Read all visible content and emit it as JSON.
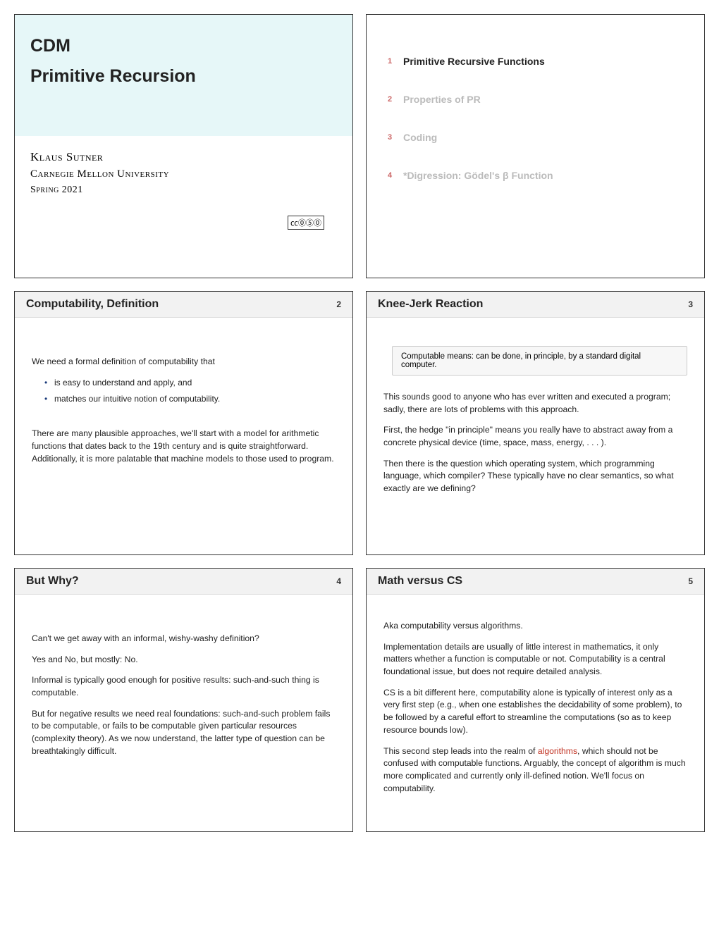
{
  "titleSlide": {
    "line1": "CDM",
    "line2": "Primitive Recursion",
    "author": "Klaus Sutner",
    "university": "Carnegie Mellon University",
    "term": "Spring 2021",
    "cc": "㏄⓪⑤⓪"
  },
  "toc": {
    "items": [
      {
        "n": "1",
        "label": "Primitive Recursive Functions",
        "active": true
      },
      {
        "n": "2",
        "label": "Properties of PR",
        "active": false
      },
      {
        "n": "3",
        "label": "Coding",
        "active": false
      },
      {
        "n": "4",
        "label": "*Digression: Gödel's β Function",
        "active": false
      }
    ]
  },
  "slides": {
    "s2": {
      "title": "Computability, Definition",
      "num": "2",
      "intro": "We need a formal definition of computability that",
      "b1": "is easy to understand and apply, and",
      "b2": "matches our intuitive notion of computability.",
      "p2": "There are many plausible approaches, we'll start with a model for arithmetic functions that dates back to the 19th century and is quite straightforward. Additionally, it is more palatable that machine models to those used to program."
    },
    "s3": {
      "title": "Knee-Jerk Reaction",
      "num": "3",
      "callout": "Computable means: can be done, in principle, by a standard digital computer.",
      "p1": "This sounds good to anyone who has ever written and executed a program; sadly, there are lots of problems with this approach.",
      "p2": "First, the hedge \"in principle\" means you really have to abstract away from a concrete physical device (time, space, mass, energy, . . . ).",
      "p3": "Then there is the question which operating system, which programming language, which compiler? These typically have no clear semantics, so what exactly are we defining?"
    },
    "s4": {
      "title": "But Why?",
      "num": "4",
      "p1": "Can't we get away with an informal, wishy-washy definition?",
      "p2": "Yes and No, but mostly: No.",
      "p3": "Informal is typically good enough for positive results: such-and-such thing is computable.",
      "p4": "But for negative results we need real foundations: such-and-such problem fails to be computable, or fails to be computable given particular resources (complexity theory). As we now understand, the latter type of question can be breathtakingly difficult."
    },
    "s5": {
      "title": "Math versus CS",
      "num": "5",
      "p1": "Aka computability versus algorithms.",
      "p2": "Implementation details are usually of little interest in mathematics, it only matters whether a function is computable or not. Computability is a central foundational issue, but does not require detailed analysis.",
      "p3": "CS is a bit different here, computability alone is typically of interest only as a very first step (e.g., when one establishes the decidability of some problem), to be followed by a careful effort to streamline the computations (so as to keep resource bounds low).",
      "p4a": "This second step leads into the realm of ",
      "p4algo": "algorithms",
      "p4b": ", which should not be confused with computable functions. Arguably, the concept of algorithm is much more complicated and currently only ill-defined notion. We'll focus on computability."
    }
  }
}
